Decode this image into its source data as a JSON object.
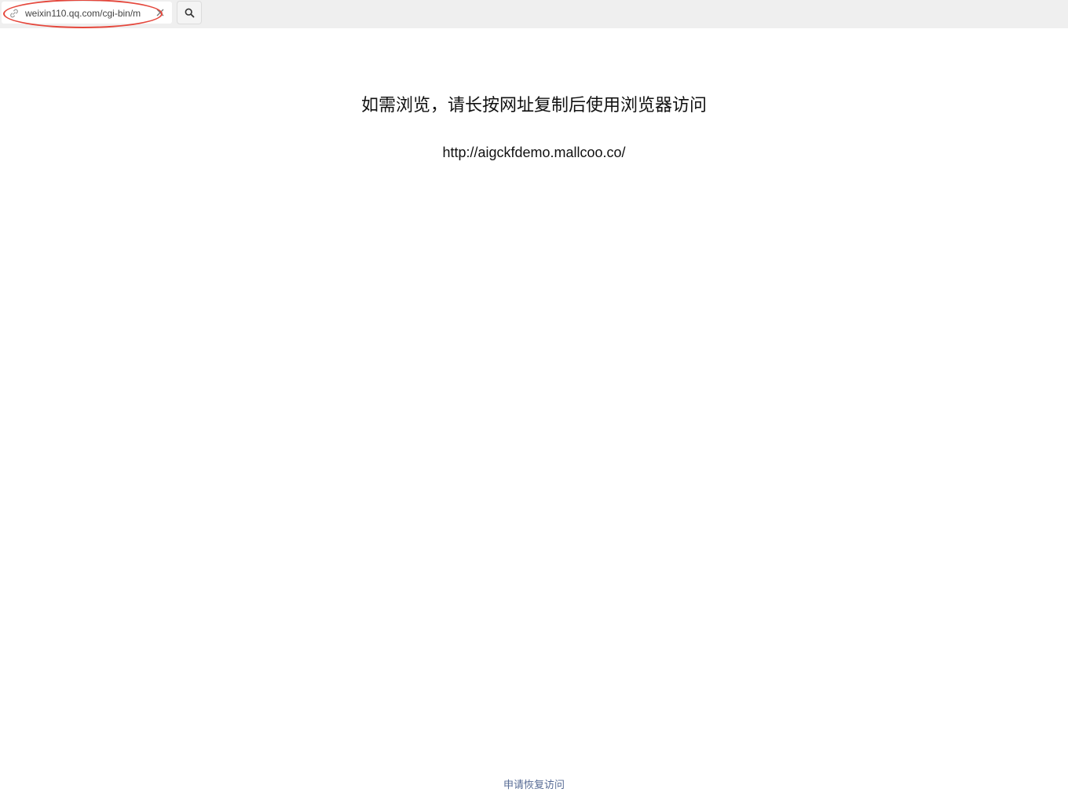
{
  "address_bar": {
    "url": "weixin110.qq.com/cgi-bin/m",
    "link_icon": "link-icon",
    "clear_icon": "close-icon"
  },
  "search_button": {
    "icon": "search-icon"
  },
  "main": {
    "message": "如需浏览，请长按网址复制后使用浏览器访问",
    "target_url": "http://aigckfdemo.mallcoo.co/"
  },
  "footer": {
    "restore_link": "申请恢复访问"
  },
  "colors": {
    "link": "#576b95",
    "highlight": "#e5473c",
    "toolbar_bg": "#efefef"
  }
}
